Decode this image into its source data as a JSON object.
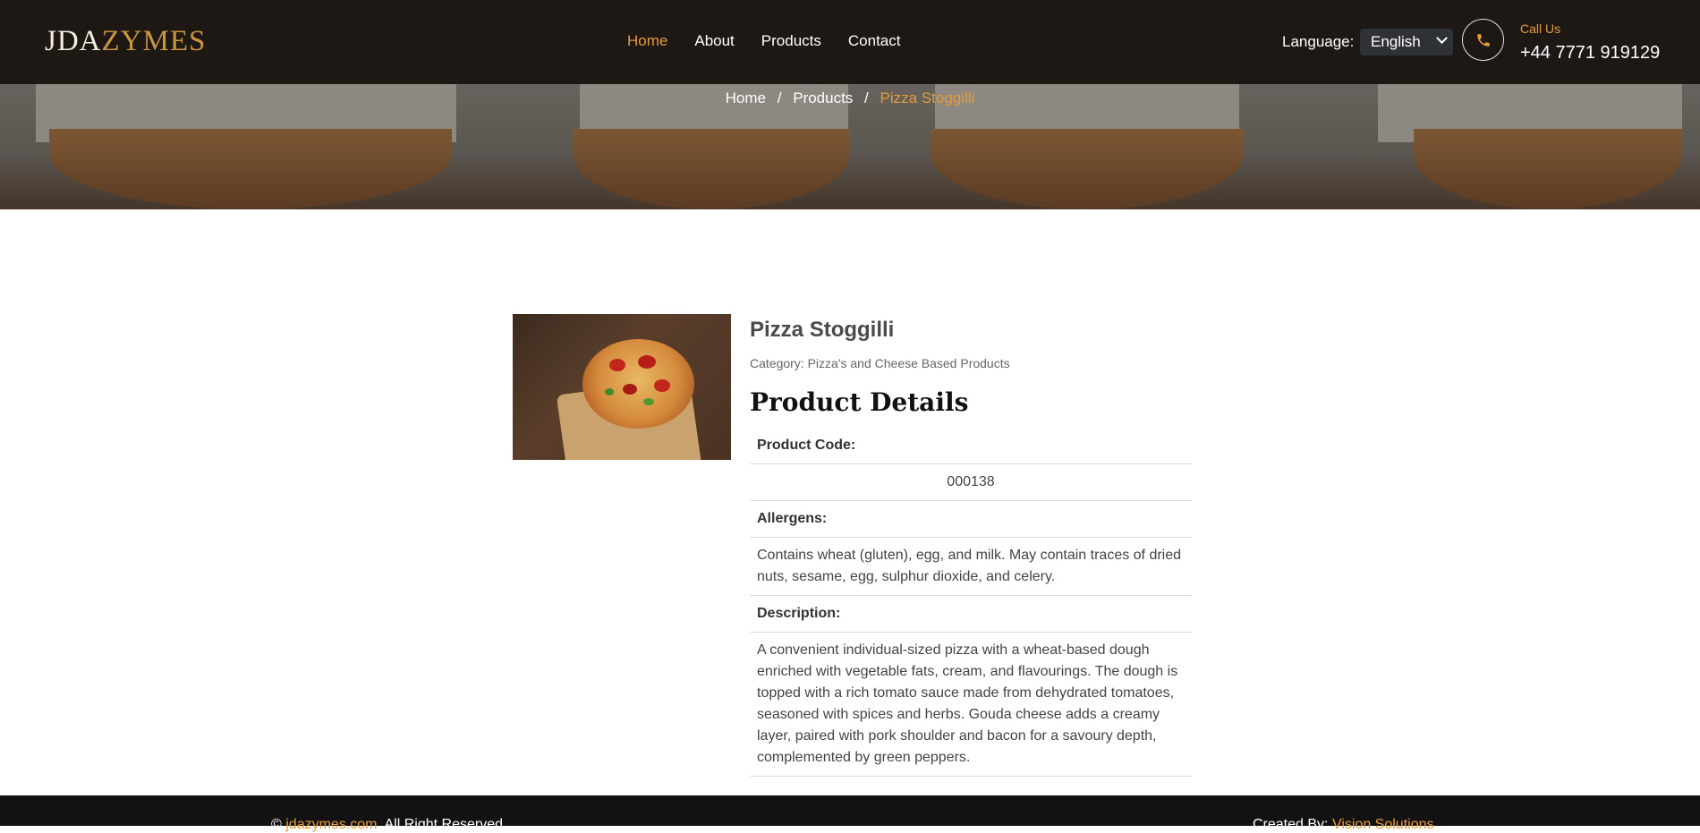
{
  "header": {
    "logo_left": "JDA",
    "logo_right": "ZYMES",
    "nav": [
      {
        "label": "Home",
        "active": true
      },
      {
        "label": "About",
        "active": false
      },
      {
        "label": "Products",
        "active": false
      },
      {
        "label": "Contact",
        "active": false
      }
    ],
    "language_label": "Language:",
    "language_value": "English",
    "call_label": "Call Us",
    "call_number": "+44 7771 919129"
  },
  "breadcrumb": {
    "home": "Home",
    "products": "Products",
    "current": "Pizza Stoggilli",
    "separator": "/"
  },
  "product": {
    "title": "Pizza Stoggilli",
    "category": "Category: Pizza's and Cheese Based Products",
    "details_heading": "Product Details",
    "code_label": "Product Code:",
    "code_value": "000138",
    "allergens_label": "Allergens:",
    "allergens_value": "Contains wheat (gluten), egg, and milk. May contain traces of dried nuts, sesame, egg, sulphur dioxide, and celery.",
    "description_label": "Description:",
    "description_value": "A convenient individual-sized pizza with a wheat-based dough enriched with vegetable fats, cream, and flavourings. The dough is topped with a rich tomato sauce made from dehydrated tomatoes, seasoned with spices and herbs. Gouda cheese adds a creamy layer, paired with pork shoulder and bacon for a savoury depth, complemented by green peppers."
  },
  "footer": {
    "copyright_prefix": "©",
    "site_link": "jdazymes.com",
    "rights": ". All Right Reserved.",
    "created_by": "Created By:",
    "creator_link": "Vision Solutions"
  },
  "colors": {
    "accent": "#e69a3c",
    "header_bg": "#1e1815",
    "footer_bg": "#121212"
  }
}
